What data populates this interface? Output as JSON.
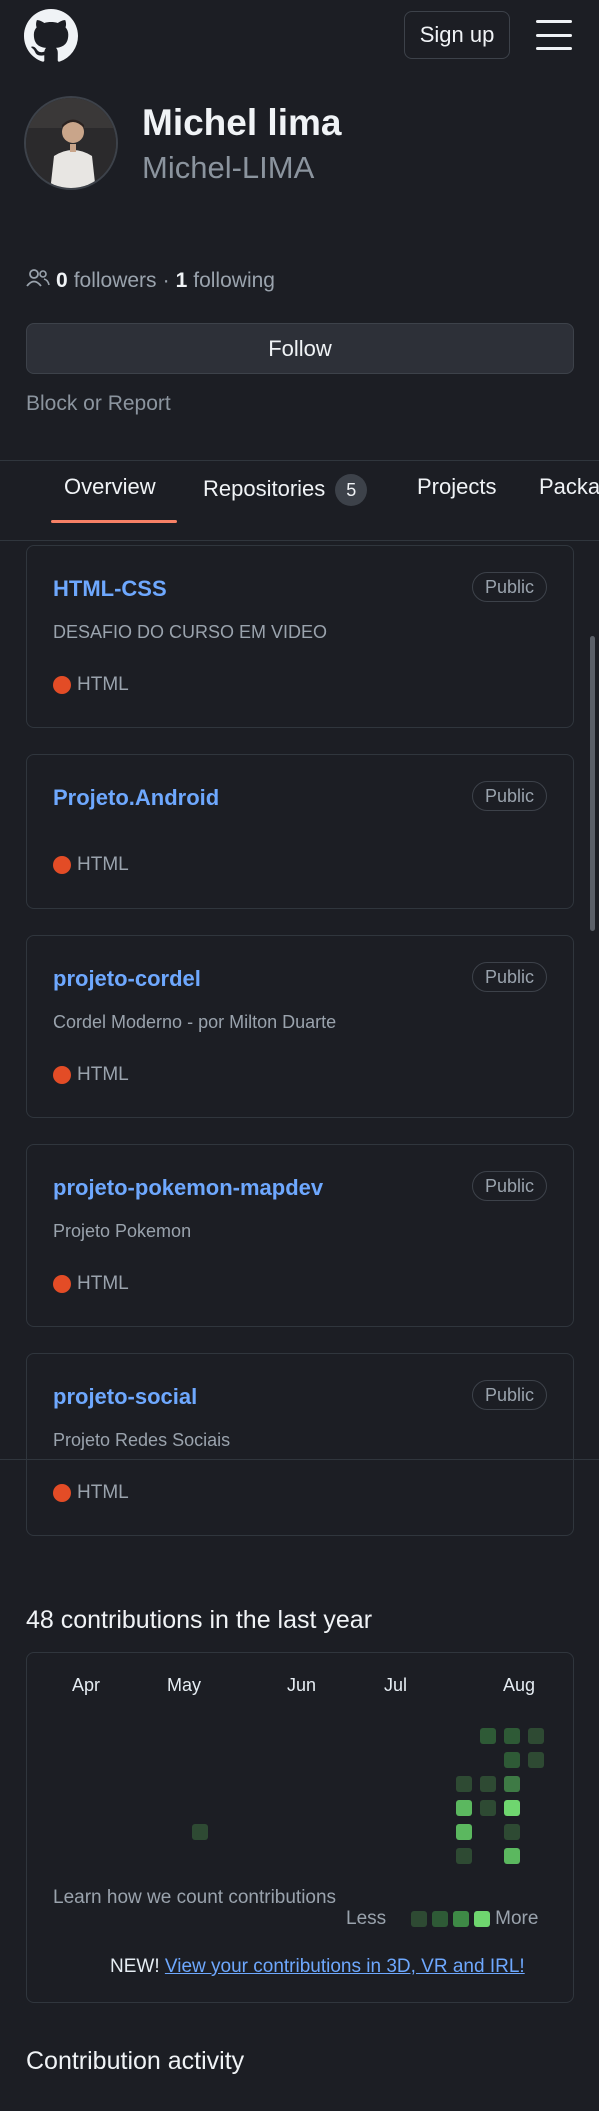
{
  "header": {
    "signup_label": "Sign up"
  },
  "profile": {
    "name": "Michel lima",
    "login": "Michel-LIMA",
    "followers_count": "0",
    "followers_label": "followers",
    "separator": "·",
    "following_count": "1",
    "following_label": "following",
    "follow_button": "Follow",
    "block_report": "Block or Report"
  },
  "tabs": [
    {
      "label": "Overview",
      "active": true
    },
    {
      "label": "Repositories",
      "count": "5"
    },
    {
      "label": "Projects"
    },
    {
      "label": "Packa"
    }
  ],
  "repos": [
    {
      "name": "HTML-CSS",
      "visibility": "Public",
      "description": "DESAFIO DO CURSO EM VIDEO",
      "language": "HTML"
    },
    {
      "name": "Projeto.Android",
      "visibility": "Public",
      "description": "",
      "language": "HTML"
    },
    {
      "name": "projeto-cordel",
      "visibility": "Public",
      "description": "Cordel Moderno - por Milton Duarte",
      "language": "HTML"
    },
    {
      "name": "projeto-pokemon-mapdev",
      "visibility": "Public",
      "description": "Projeto Pokemon",
      "language": "HTML"
    },
    {
      "name": "projeto-social",
      "visibility": "Public",
      "description": "Projeto Redes Sociais",
      "language": "HTML"
    }
  ],
  "language_color": "#e34c26",
  "contributions": {
    "title": "48 contributions in the last year",
    "months": [
      "Apr",
      "May",
      "Jun",
      "Jul",
      "Aug"
    ],
    "learn_link": "Learn how we count contributions",
    "legend_less": "Less",
    "legend_more": "More",
    "new_label": "NEW!",
    "new_link": "View your contributions in 3D, VR and IRL!"
  },
  "activity_title": "Contribution activity",
  "colors": {
    "link": "#6ea8fe",
    "accent_tab": "#f78166",
    "bg": "#1c1e24"
  }
}
